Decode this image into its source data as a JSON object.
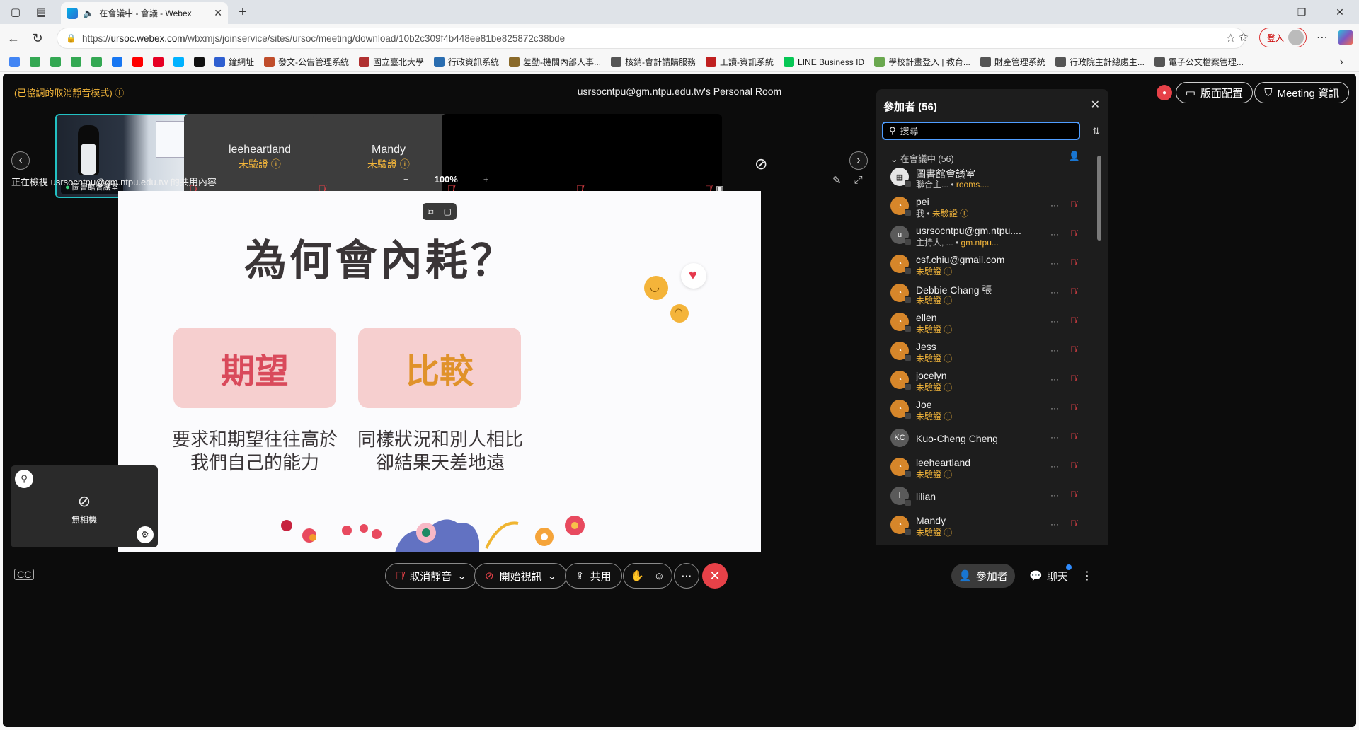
{
  "browser": {
    "tab_title": "在會議中 - 會議 - Webex",
    "url_scheme": "https://",
    "url_host": "ursoc.webex.com",
    "url_path": "/wbxmjs/joinservice/sites/ursoc/meeting/download/10b2c309f4b448ee81be825872c38bde",
    "login_label": "登入",
    "bookmarks": [
      {
        "label": "",
        "color": "#4285f4"
      },
      {
        "label": "",
        "color": "#34a853"
      },
      {
        "label": "",
        "color": "#34a853"
      },
      {
        "label": "",
        "color": "#34a853"
      },
      {
        "label": "",
        "color": "#34a853"
      },
      {
        "label": "",
        "color": "#1877f2"
      },
      {
        "label": "",
        "color": "#ff0000"
      },
      {
        "label": "",
        "color": "#e60023"
      },
      {
        "label": "",
        "color": "#00b2ff"
      },
      {
        "label": "",
        "color": "#111111"
      },
      {
        "label": "鐘網址",
        "color": "#2f5fd0"
      },
      {
        "label": "發文-公告管理系統",
        "color": "#c04d2b"
      },
      {
        "label": "國立臺北大學",
        "color": "#b03030"
      },
      {
        "label": "行政資訊系統",
        "color": "#2a6db0"
      },
      {
        "label": "差勤-機關內部人事...",
        "color": "#8a6a2a"
      },
      {
        "label": "核銷-會計請購服務",
        "color": "#555555"
      },
      {
        "label": "工讀-資訊系統",
        "color": "#c02020"
      },
      {
        "label": "LINE Business ID",
        "color": "#06c755"
      },
      {
        "label": "學校計畫登入 | 教育...",
        "color": "#6aa84f"
      },
      {
        "label": "財產管理系統",
        "color": "#555555"
      },
      {
        "label": "行政院主計總處主...",
        "color": "#555555"
      },
      {
        "label": "電子公文檔案管理...",
        "color": "#555555"
      }
    ]
  },
  "meeting": {
    "mode_label": "(已協調的取消靜音模式)",
    "room_title": "usrsocntpu@gm.ntpu.edu.tw's Personal Room",
    "layout_button": "版面配置",
    "info_button": "Meeting 資訊",
    "tiles": [
      {
        "name": "圖書館會議室",
        "status": "",
        "type": "video"
      },
      {
        "name": "leeheartland",
        "status": "未驗證",
        "type": "avatar"
      },
      {
        "name": "Mandy",
        "status": "未驗證",
        "type": "avatar"
      },
      {
        "name": "",
        "status": "",
        "type": "black"
      },
      {
        "name": "",
        "status": "",
        "type": "black"
      }
    ],
    "viewing_label": "正在檢視 usrsocntpu@gm.ntpu.edu.tw 的共用內容",
    "zoom_level": "100%",
    "slide": {
      "title": "為何會內耗？",
      "box1": "期望",
      "box2": "比較",
      "desc1_line1": "要求和期望往往高於",
      "desc1_line2": "我們自己的能力",
      "desc2_line1": "同樣狀況和別人相比",
      "desc2_line2": "卻結果天差地遠"
    },
    "self_view_label": "無相機",
    "controls": {
      "unmute": "取消靜音",
      "start_video": "開始視訊",
      "share": "共用",
      "participants": "參加者",
      "chat": "聊天"
    }
  },
  "participants": {
    "title": "參加者 (56)",
    "search_placeholder": "搜尋",
    "section": "在會議中 (56)",
    "list": [
      {
        "name": "圖書館會議室",
        "sub1": "聯合主...",
        "sub2": "rooms....",
        "avatar": "white",
        "initials": "▦"
      },
      {
        "name": "pei",
        "sub1": "我",
        "sub2": "未驗證",
        "avatar": "orange",
        "initials": "◔"
      },
      {
        "name": "usrsocntpu@gm.ntpu....",
        "sub1": "主持人, ...",
        "sub2": "gm.ntpu...",
        "avatar": "gray",
        "initials": "u"
      },
      {
        "name": "csf.chiu@gmail.com",
        "sub1": "",
        "sub2": "未驗證",
        "avatar": "orange",
        "initials": "◔"
      },
      {
        "name": "Debbie Chang 張",
        "sub1": "",
        "sub2": "未驗證",
        "avatar": "orange",
        "initials": "◔"
      },
      {
        "name": "ellen",
        "sub1": "",
        "sub2": "未驗證",
        "avatar": "orange",
        "initials": "◔"
      },
      {
        "name": "Jess",
        "sub1": "",
        "sub2": "未驗證",
        "avatar": "orange",
        "initials": "◔"
      },
      {
        "name": "jocelyn",
        "sub1": "",
        "sub2": "未驗證",
        "avatar": "orange",
        "initials": "◔"
      },
      {
        "name": "Joe",
        "sub1": "",
        "sub2": "未驗證",
        "avatar": "orange",
        "initials": "◔"
      },
      {
        "name": "Kuo-Cheng Cheng",
        "sub1": "",
        "sub2": "",
        "avatar": "gray",
        "initials": "KC"
      },
      {
        "name": "leeheartland",
        "sub1": "",
        "sub2": "未驗證",
        "avatar": "orange",
        "initials": "◔"
      },
      {
        "name": "lilian",
        "sub1": "",
        "sub2": "",
        "avatar": "gray",
        "initials": "l"
      },
      {
        "name": "Mandy",
        "sub1": "",
        "sub2": "未驗證",
        "avatar": "orange",
        "initials": "◔"
      }
    ]
  }
}
